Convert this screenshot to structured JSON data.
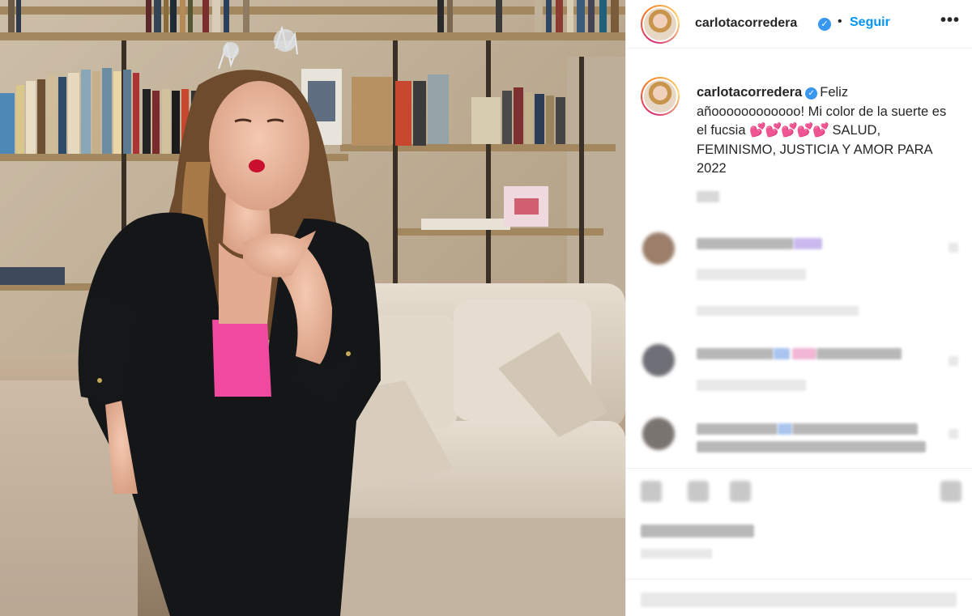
{
  "post": {
    "username": "carlotacorredera",
    "verified_icon": "verified-badge-icon",
    "separator": "•",
    "follow_label": "Seguir",
    "more_label": "•••",
    "caption": {
      "username": "carlotacorredera",
      "text_before": "Feliz añoooooooooooo! Mi color de la suerte es el fucsia ",
      "hearts": "💕💕💕💕💕",
      "text_after": " SALUD, FEMINISMO, JUSTICIA Y AMOR PARA 2022"
    }
  },
  "colors": {
    "accent_blue": "#0095f6",
    "verified_blue": "#3897f0",
    "text": "#262626",
    "divider": "#efefef",
    "top_pink": "#ef4aa0"
  },
  "icons": [
    "verified-badge-icon",
    "more-options-icon",
    "like-icon",
    "comment-icon",
    "share-icon",
    "save-icon"
  ]
}
